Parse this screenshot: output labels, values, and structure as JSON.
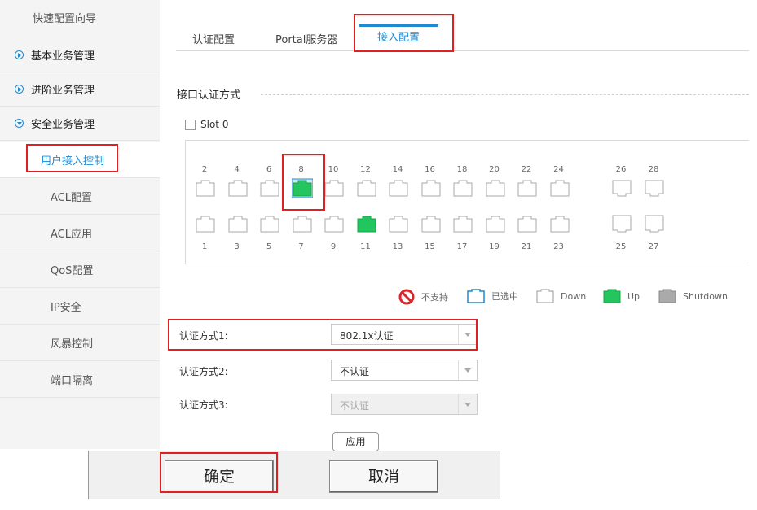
{
  "sidebar": {
    "top_item": "快速配置向导",
    "groups": [
      "基本业务管理",
      "进阶业务管理",
      "安全业务管理"
    ],
    "sub_items": [
      "用户接入控制",
      "ACL配置",
      "ACL应用",
      "QoS配置",
      "IP安全",
      "风暴控制",
      "端口隔离"
    ],
    "active_sub": "用户接入控制"
  },
  "tabs": [
    {
      "label": "认证配置",
      "active": false
    },
    {
      "label": "Portal服务器",
      "active": false
    },
    {
      "label": "接入配置",
      "active": true
    }
  ],
  "section_title": "接口认证方式",
  "slot_label": "Slot 0",
  "ports": {
    "top_labels": [
      "2",
      "4",
      "6",
      "8",
      "10",
      "12",
      "14",
      "16",
      "18",
      "20",
      "22",
      "24",
      "26",
      "28"
    ],
    "bottom_labels": [
      "1",
      "3",
      "5",
      "7",
      "9",
      "11",
      "13",
      "15",
      "17",
      "19",
      "21",
      "23",
      "25",
      "27"
    ],
    "selected_port": "8",
    "up_ports": [
      "8",
      "11"
    ]
  },
  "legend": {
    "unsupported": "不支持",
    "selected": "已选中",
    "down": "Down",
    "up": "Up",
    "shutdown": "Shutdown"
  },
  "auth_methods": [
    {
      "label": "认证方式1:",
      "value": "802.1x认证",
      "disabled": false
    },
    {
      "label": "认证方式2:",
      "value": "不认证",
      "disabled": false
    },
    {
      "label": "认证方式3:",
      "value": "不认证",
      "disabled": true
    }
  ],
  "apply_label": "应用",
  "dialog": {
    "ok": "确定",
    "cancel": "取消"
  },
  "colors": {
    "accent": "#1f8ad1",
    "port_up": "#22c55e",
    "highlight": "#e02020"
  }
}
